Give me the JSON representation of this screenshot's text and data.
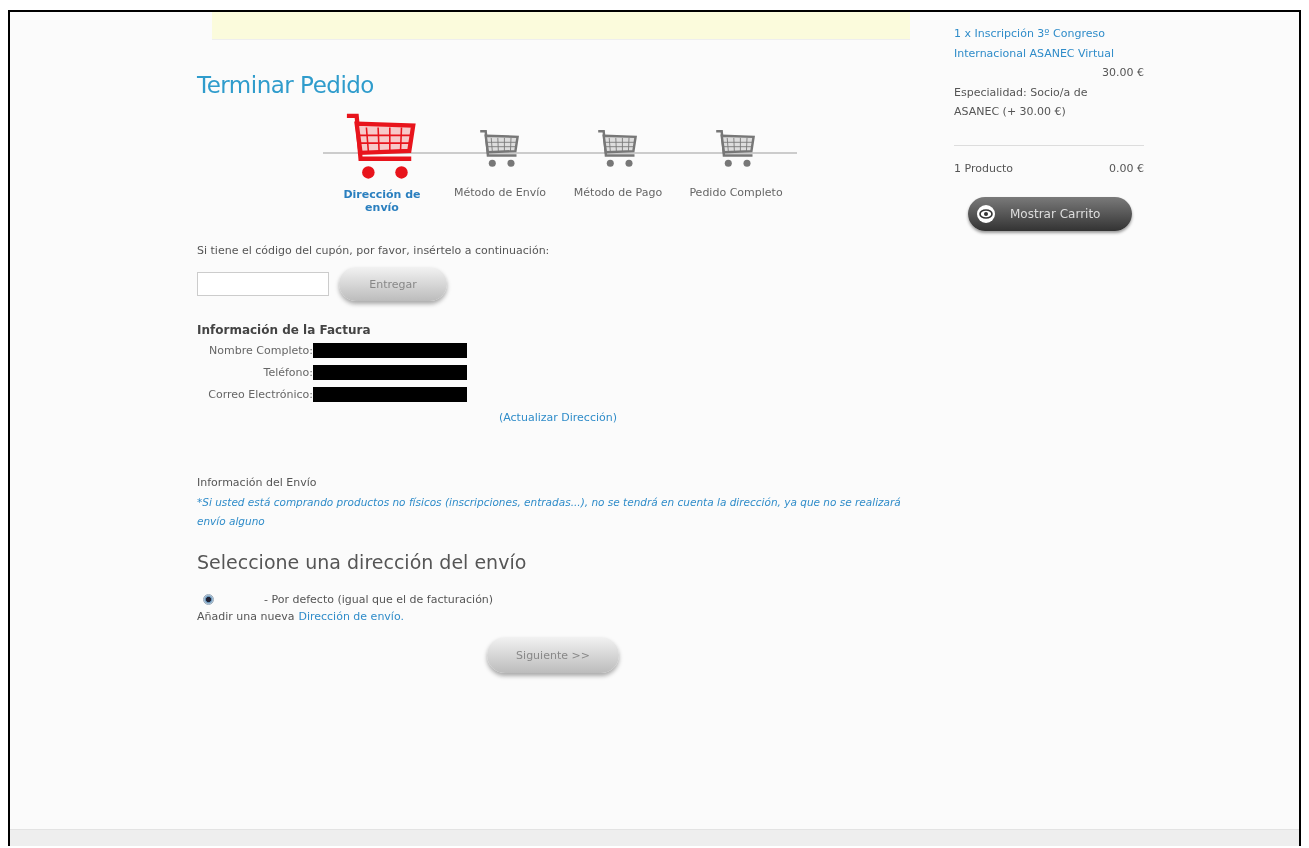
{
  "page_title": "Terminar Pedido",
  "steps": [
    {
      "label": "Dirección de envío",
      "selected": true
    },
    {
      "label": "Método de Envío",
      "selected": false
    },
    {
      "label": "Método de Pago",
      "selected": false
    },
    {
      "label": "Pedido Completo",
      "selected": false
    }
  ],
  "coupon": {
    "prompt": "Si tiene el código del cupón, por favor, insértelo a continuación:",
    "button": "Entregar"
  },
  "invoice": {
    "title": "Información de la Factura",
    "fields": [
      {
        "label": "Nombre Completo:"
      },
      {
        "label": "Teléfono:"
      },
      {
        "label": "Correo Electrónico:"
      }
    ],
    "update_link": "(Actualizar Dirección)"
  },
  "shipping_info": {
    "title": "Información del Envío",
    "note": "*Si usted está comprando productos no físicos (inscripciones, entradas...), no se tendrá en cuenta la dirección, ya que no se realizará envío alguno"
  },
  "address_select": {
    "title": "Seleccione una dirección del envío",
    "options": [
      {
        "label": "- Por defecto (igual que el de facturación)",
        "selected": true
      }
    ],
    "add_prefix": "Añadir una nueva",
    "add_link": "Dirección de envío."
  },
  "next_button": "Siguiente >>",
  "cart": {
    "item": "1 x Inscripción 3º Congreso Internacional ASANEC Virtual",
    "item_price": "30.00 €",
    "detail": "Especialidad: Socio/a de ASANEC (+ 30.00 €)",
    "count": "1 Producto",
    "total": "0.00 €",
    "show_button": "Mostrar Carrito"
  }
}
